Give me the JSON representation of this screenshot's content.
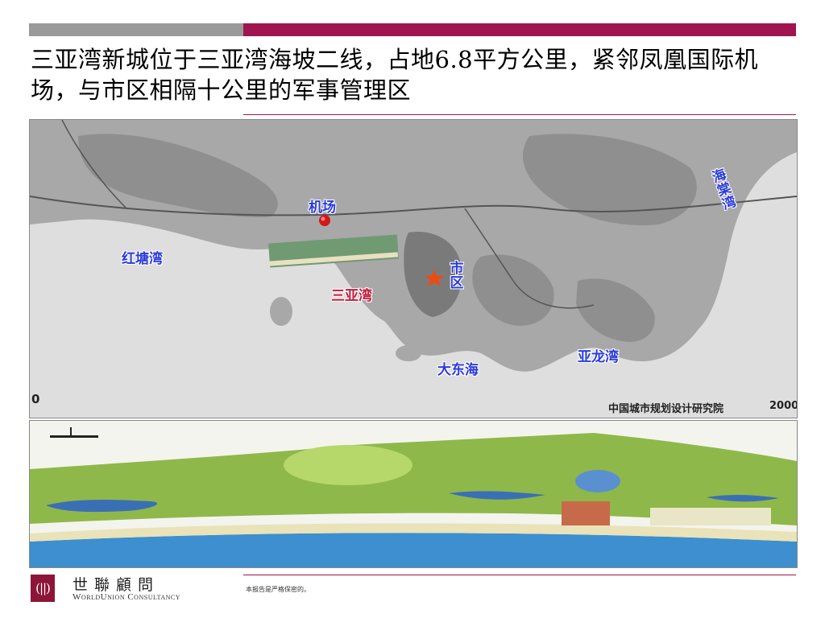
{
  "title": "三亚湾新城位于三亚湾海坡二线，占地6.8平方公里，紧邻凤凰国际机场，与市区相隔十公里的军事管理区",
  "map": {
    "labels": {
      "airport": "机场",
      "hongtang_bay": "红塘湾",
      "sanya_bay": "三亚湾",
      "city_district": "市区",
      "dadonghai": "大东海",
      "yalong_bay": "亚龙湾",
      "haitang_bay": "海棠湾"
    },
    "source": "中国城市规划设计研究院",
    "year": "2000",
    "left_edge_digit": "0",
    "colors": {
      "land": "#a9a9a9",
      "sea": "#dcdcdc",
      "label_blue": "#2a3ad8",
      "label_red": "#c41a3a",
      "marker": "#d01818"
    }
  },
  "footer": {
    "company_cn": "世聯顧問",
    "company_en": "WorldUnion Consultancy",
    "note": "本报告是严格保密的。",
    "logo_mark": "(||)"
  },
  "colors": {
    "accent": "#a01450",
    "gray_bar": "#9a9a9a"
  }
}
